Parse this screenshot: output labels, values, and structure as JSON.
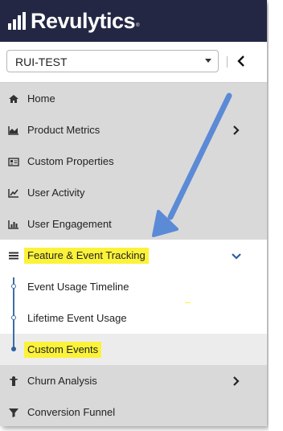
{
  "app": {
    "brand": "Revulytics",
    "trademark": "®"
  },
  "product_selector": {
    "value": "RUI-TEST"
  },
  "nav": {
    "items": [
      {
        "label": "Home",
        "icon": "home-icon"
      },
      {
        "label": "Product Metrics",
        "icon": "area-chart-icon",
        "expandable": true
      },
      {
        "label": "Custom Properties",
        "icon": "id-card-icon"
      },
      {
        "label": "User Activity",
        "icon": "line-chart-icon"
      },
      {
        "label": "User Engagement",
        "icon": "bar-chart-icon"
      },
      {
        "label": "Feature & Event Tracking",
        "icon": "list-icon",
        "expanded": true,
        "highlighted": true
      },
      {
        "label": "Churn Analysis",
        "icon": "person-icon",
        "expandable": true
      },
      {
        "label": "Conversion Funnel",
        "icon": "funnel-icon"
      }
    ],
    "sub_items": [
      {
        "label": "Event Usage Timeline"
      },
      {
        "label": "Lifetime Event Usage"
      },
      {
        "label": "Custom Events",
        "active": true,
        "highlighted": true
      }
    ]
  },
  "colors": {
    "header_bg": "#242744",
    "highlight": "#fbf23a",
    "accent": "#2e5f9e",
    "arrow": "#5b8ad6"
  }
}
